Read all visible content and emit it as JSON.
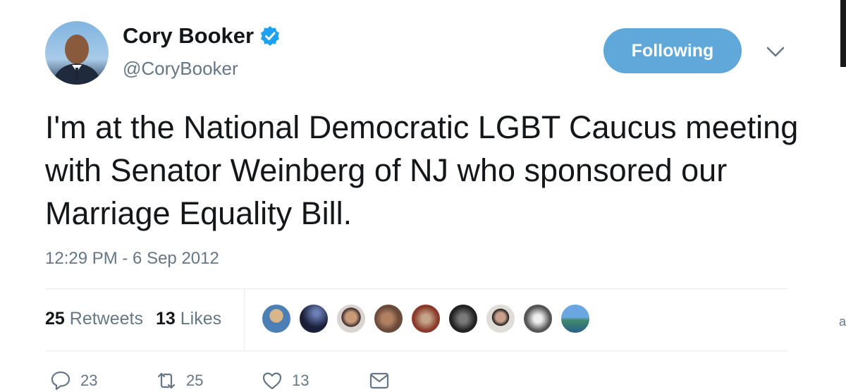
{
  "author": {
    "name": "Cory Booker",
    "handle": "@CoryBooker",
    "verified_icon": "verified-badge-icon",
    "avatar": "profile-photo"
  },
  "follow_button": {
    "label": "Following"
  },
  "menu_icon": "chevron-down-icon",
  "tweet": {
    "text": "I'm at the National Democratic LGBT Caucus meeting with Senator Weinberg of NJ who sponsored our Marriage Equality Bill.",
    "timestamp": "12:29 PM - 6 Sep 2012"
  },
  "stats": {
    "retweets_count": "25",
    "retweets_label": "Retweets",
    "likes_count": "13",
    "likes_label": "Likes"
  },
  "liker_avatars": [
    "liker-1",
    "liker-2",
    "liker-3",
    "liker-4",
    "liker-5",
    "liker-6",
    "liker-7",
    "liker-8",
    "liker-9"
  ],
  "actions": {
    "reply_count": "23",
    "retweet_count": "25",
    "like_count": "13"
  },
  "colors": {
    "accent": "#5fa8d9",
    "text": "#14171a",
    "muted": "#657786",
    "verified": "#1da1f2"
  }
}
